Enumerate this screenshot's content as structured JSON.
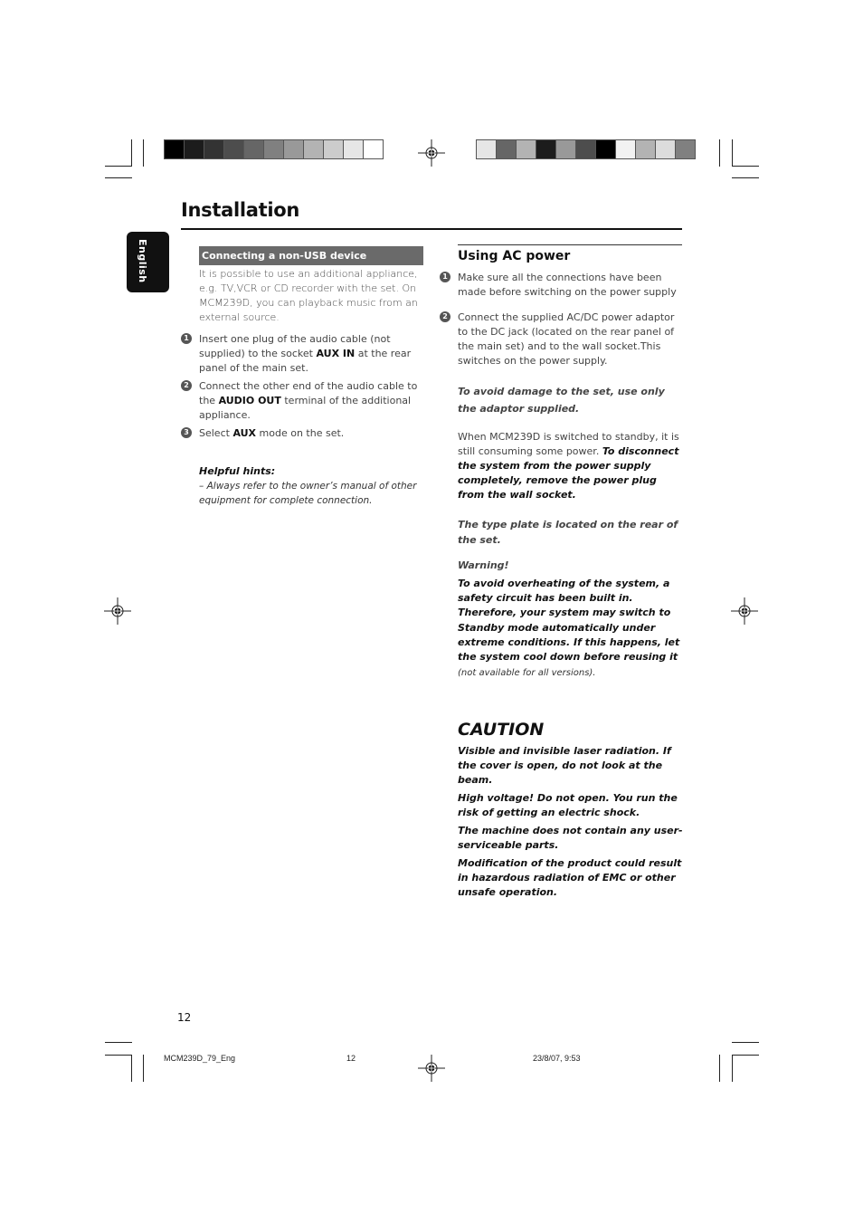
{
  "header": {
    "title": "Installation",
    "language_tab": "English"
  },
  "colors": {
    "section_bar": "#6a6a6a",
    "language_tab": "#111111",
    "left_strip": [
      "#000000",
      "#1c1c1c",
      "#333333",
      "#4d4d4d",
      "#666666",
      "#808080",
      "#999999",
      "#b3b3b3",
      "#cccccc",
      "#e6e6e6",
      "#ffffff"
    ],
    "right_strip": [
      "#e6e6e6",
      "#666666",
      "#b3b3b3",
      "#1c1c1c",
      "#999999",
      "#4d4d4d",
      "#000000",
      "#f2f2f2",
      "#b3b3b3",
      "#dcdcdc",
      "#808080"
    ]
  },
  "left_column": {
    "section_title": "Connecting a non-USB device",
    "intro": "It is possible to use an additional appliance, e.g. TV,VCR or CD recorder with the set. On MCM239D, you can playback music from an external source.",
    "steps": [
      {
        "num": "1",
        "pre": "Insert one plug of the audio cable (not supplied) to the socket ",
        "bold": "AUX IN",
        "post": " at the rear panel of the main set."
      },
      {
        "num": "2",
        "pre": "Connect the other end of the audio cable to the ",
        "bold": "AUDIO OUT",
        "post": " terminal of the additional appliance."
      },
      {
        "num": "3",
        "pre": "Select ",
        "bold": "AUX",
        "post": " mode on the set."
      }
    ],
    "hints": {
      "heading": "Helpful hints:",
      "body": "–  Always refer to the owner’s manual of other equipment for complete connection."
    }
  },
  "right_column": {
    "section_title": "Using AC power",
    "steps": [
      {
        "num": "1",
        "text": "Make sure all the connections have been made before switching on the power supply"
      },
      {
        "num": "2",
        "text": "Connect the supplied AC/DC power adaptor to the DC jack (located on the rear panel of the main set) and to the wall socket.This switches on the power supply."
      }
    ],
    "damage_note": "To avoid damage to the set, use only the adaptor supplied.",
    "standby_pre": "When MCM239D is switched to standby, it is still consuming some power. ",
    "standby_bold": "To disconnect the system from the power supply completely, remove the power plug from the wall socket.",
    "type_plate": "The type plate is located on the rear of the set.",
    "warning_heading": "Warning!",
    "warning_bold": "To avoid overheating of the system, a safety circuit has been built in.  Therefore, your system may switch to Standby mode automatically under extreme conditions.  If this happens, let the system cool down before reusing it",
    "warning_note": " (not available for all versions).",
    "caution": {
      "title": "CAUTION",
      "paragraphs": [
        "Visible and invisible laser radiation. If the cover is open, do not look at the beam.",
        "High voltage! Do not open. You run the risk of getting an electric shock.",
        "The machine does not contain any user-serviceable parts.",
        "Modification of the product could result in hazardous radiation of EMC or other unsafe operation."
      ]
    }
  },
  "footer": {
    "page_number": "12",
    "slug_file": "MCM239D_79_Eng",
    "slug_page": "12",
    "slug_date": "23/8/07, 9:53"
  }
}
